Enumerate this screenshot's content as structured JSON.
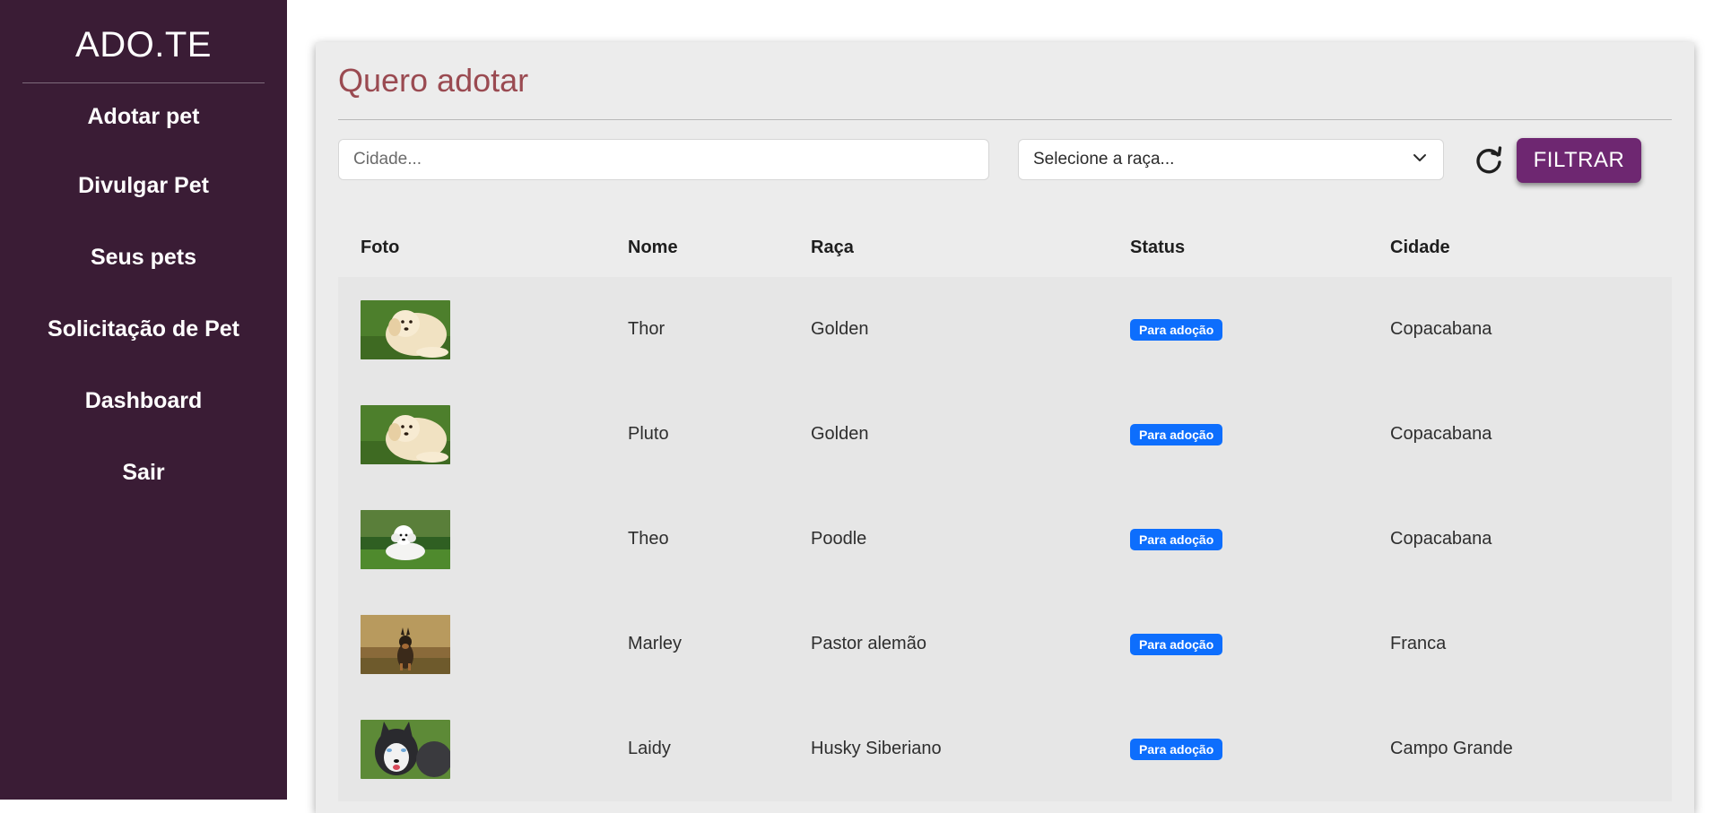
{
  "sidebar": {
    "brand": "ADO.TE",
    "items": [
      {
        "label": "Adotar pet"
      },
      {
        "label": "Divulgar Pet"
      },
      {
        "label": "Seus pets"
      },
      {
        "label": "Solicitação de Pet"
      },
      {
        "label": "Dashboard"
      },
      {
        "label": "Sair"
      }
    ]
  },
  "main": {
    "title": "Quero adotar",
    "filters": {
      "city_placeholder": "Cidade...",
      "city_value": "",
      "breed_selected": "Selecione a raça...",
      "filter_label": "FILTRAR"
    },
    "table": {
      "headers": [
        "Foto",
        "Nome",
        "Raça",
        "Status",
        "Cidade"
      ],
      "rows": [
        {
          "photo": "golden-retriever-puppy-photo",
          "name": "Thor",
          "breed": "Golden",
          "status": "Para adoção",
          "city": "Copacabana"
        },
        {
          "photo": "golden-retriever-puppy-photo",
          "name": "Pluto",
          "breed": "Golden",
          "status": "Para adoção",
          "city": "Copacabana"
        },
        {
          "photo": "white-poodle-photo",
          "name": "Theo",
          "breed": "Poodle",
          "status": "Para adoção",
          "city": "Copacabana"
        },
        {
          "photo": "german-shepherd-photo",
          "name": "Marley",
          "breed": "Pastor alemão",
          "status": "Para adoção",
          "city": "Franca"
        },
        {
          "photo": "siberian-husky-photo",
          "name": "Laidy",
          "breed": "Husky Siberiano",
          "status": "Para adoção",
          "city": "Campo Grande"
        }
      ]
    }
  },
  "colors": {
    "sidebar_bg": "#3a1c35",
    "title": "#9a4a51",
    "filter_button": "#6e2771",
    "badge": "#0d6efd",
    "card_bg": "#ececec"
  }
}
